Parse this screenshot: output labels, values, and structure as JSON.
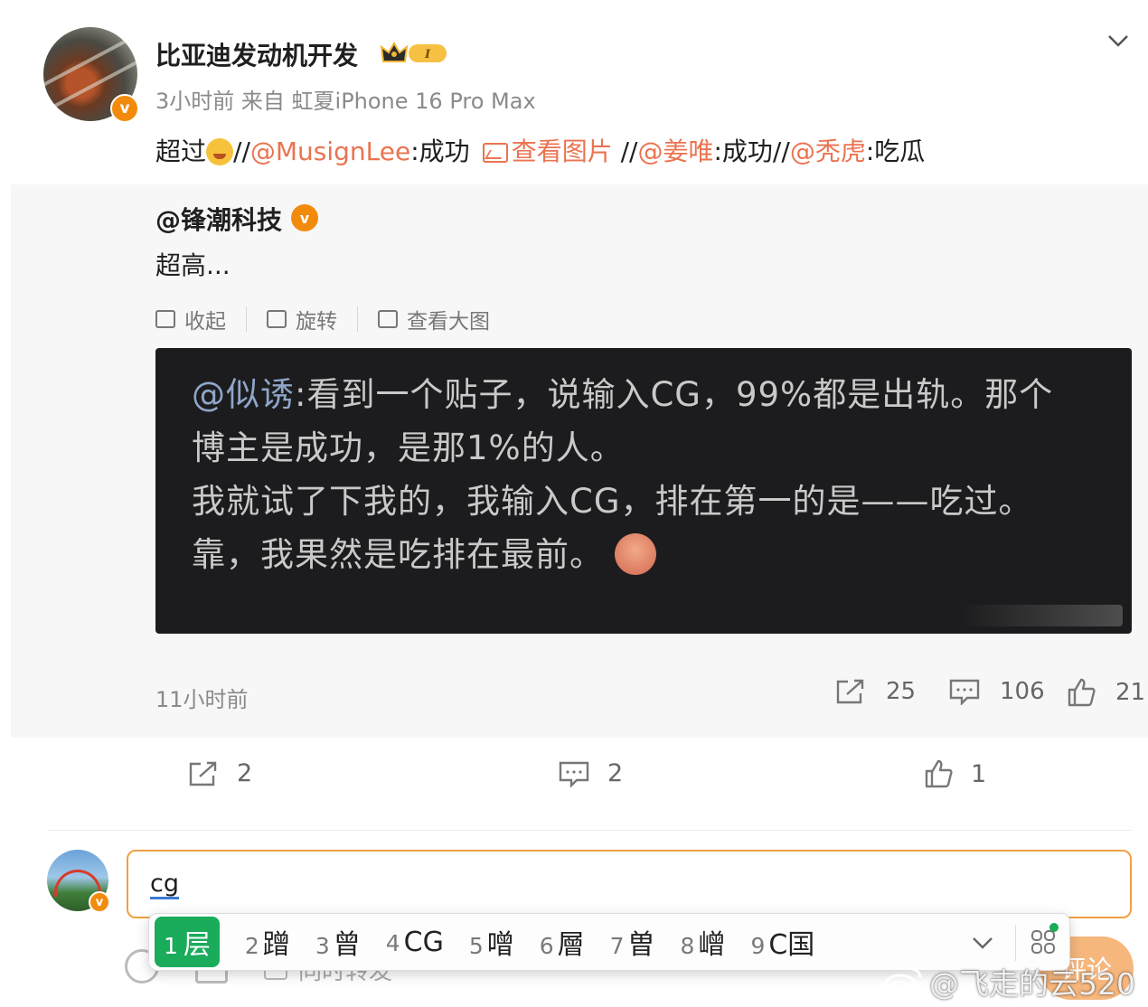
{
  "post": {
    "username": "比亚迪发动机开发",
    "level_badge": "I",
    "meta": "3小时前 来自 虹夏iPhone 16 Pro Max",
    "content": {
      "prefix": "超过",
      "sep1": "//",
      "mention1": "@MusignLee",
      "text1": ":成功",
      "view_image": "查看图片",
      "sep2": " //",
      "mention2": "@姜唯",
      "text2": ":成功//",
      "mention3": "@秃虎",
      "text3": ":吃瓜"
    },
    "actions": {
      "share": "2",
      "comment": "2",
      "like": "1"
    }
  },
  "repost": {
    "username": "@锋潮科技",
    "text": "超高...",
    "tools": {
      "collapse": "收起",
      "rotate": "旋转",
      "view_large": "查看大图"
    },
    "image_text": {
      "mention": "@似诱",
      "line1": ":看到一个贴子，说输入CG，99%都是出轨。那个",
      "line2": "博主是成功，是那1%的人。",
      "line3": "我就试了下我的，我输入CG，排在第一的是——吃过。",
      "line4": "靠，我果然是吃排在最前。"
    },
    "time": "11小时前",
    "actions": {
      "share": "25",
      "comment": "106",
      "like": "21"
    }
  },
  "comment_input": {
    "value": "cg",
    "sync_repost_label": "同时转发",
    "send_label": "评论"
  },
  "ime": {
    "candidates": [
      {
        "num": "1",
        "text": "层"
      },
      {
        "num": "2",
        "text": "蹭"
      },
      {
        "num": "3",
        "text": "曾"
      },
      {
        "num": "4",
        "text": "CG"
      },
      {
        "num": "5",
        "text": "噌"
      },
      {
        "num": "6",
        "text": "層"
      },
      {
        "num": "7",
        "text": "曽"
      },
      {
        "num": "8",
        "text": "嶒"
      },
      {
        "num": "9",
        "text": "C国"
      }
    ],
    "highlight_color": "#1aab5b"
  },
  "watermark": "@飞走的云520",
  "colors": {
    "mention": "#eb7350",
    "vip_badge": "#f28b0c",
    "input_border": "#f0a043"
  }
}
